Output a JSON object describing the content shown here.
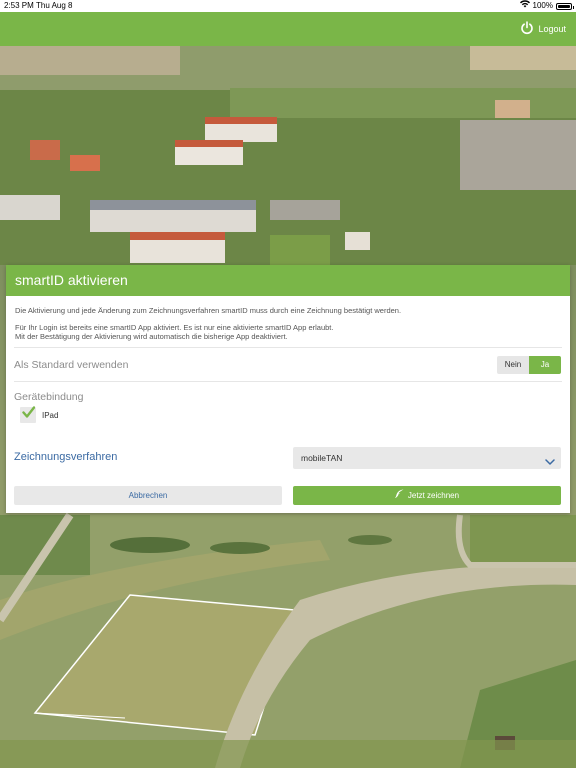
{
  "status_bar": {
    "time": "2:53 PM",
    "date": "Thu Aug 8",
    "battery": "100%",
    "battery_level": 1.0
  },
  "header": {
    "logout_label": "Logout",
    "color": "#7ab648"
  },
  "modal": {
    "title": "smartID aktivieren",
    "info_line_1": "Die Aktivierung und jede Änderung zum Zeichnungsverfahren smartID muss durch eine Zeichnung bestätigt werden.",
    "info_line_2": "Für Ihr Login ist bereits eine smartID App aktiviert. Es ist nur eine aktivierte smartID App erlaubt.",
    "info_line_3": "Mit der Bestätigung der Aktivierung wird automatisch die bisherige App deaktiviert.",
    "standard": {
      "label": "Als Standard verwenden",
      "option_no": "Nein",
      "option_yes": "Ja",
      "selected": "Ja"
    },
    "device_binding": {
      "label": "Gerätebindung",
      "device": "IPad",
      "checked": true
    },
    "signing_method": {
      "label": "Zeichnungsverfahren",
      "value": "mobileTAN"
    },
    "cancel_label": "Abbrechen",
    "sign_label": "Jetzt zeichnen"
  },
  "colors": {
    "accent": "#7ab648",
    "link_blue": "#3b6aa3"
  }
}
